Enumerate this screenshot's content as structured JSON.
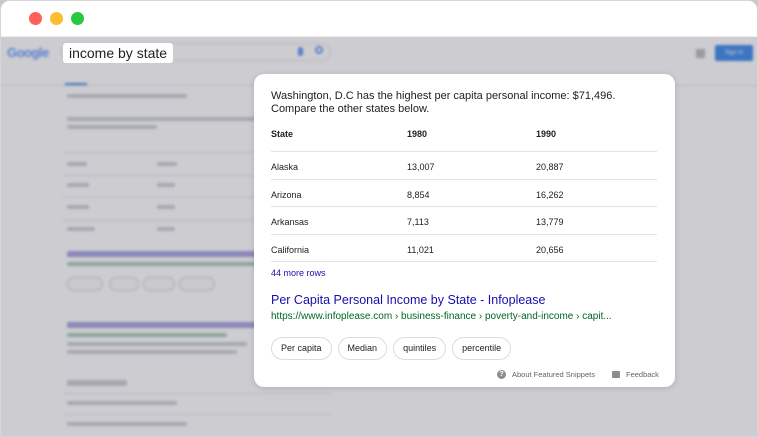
{
  "browser": {
    "controls": [
      "close",
      "minimize",
      "maximize"
    ]
  },
  "google": {
    "logo": "Google",
    "query": "income by state",
    "sign_in": "Sign in"
  },
  "snippet": {
    "intro": "Washington, D.C has the highest per capita personal income: $71,496. Compare the other states below.",
    "columns": [
      "State",
      "1980",
      "1990"
    ],
    "rows": [
      [
        "Alaska",
        "13,007",
        "20,887"
      ],
      [
        "Arizona",
        "8,854",
        "16,262"
      ],
      [
        "Arkansas",
        "7,113",
        "13,779"
      ],
      [
        "California",
        "11,021",
        "20,656"
      ]
    ],
    "more_rows": "44 more rows",
    "result_title": "Per Capita Personal Income by State - Infoplease",
    "result_url": "https://www.infoplease.com › business-finance › poverty-and-income › capit...",
    "chips": [
      "Per capita",
      "Median",
      "quintiles",
      "percentile"
    ],
    "about": "About Featured Snippets",
    "feedback": "Feedback"
  },
  "icons": {
    "about": "help-circle-icon",
    "feedback": "feedback-icon",
    "search": "search-icon",
    "mic": "mic-icon",
    "apps": "apps-grid-icon"
  }
}
